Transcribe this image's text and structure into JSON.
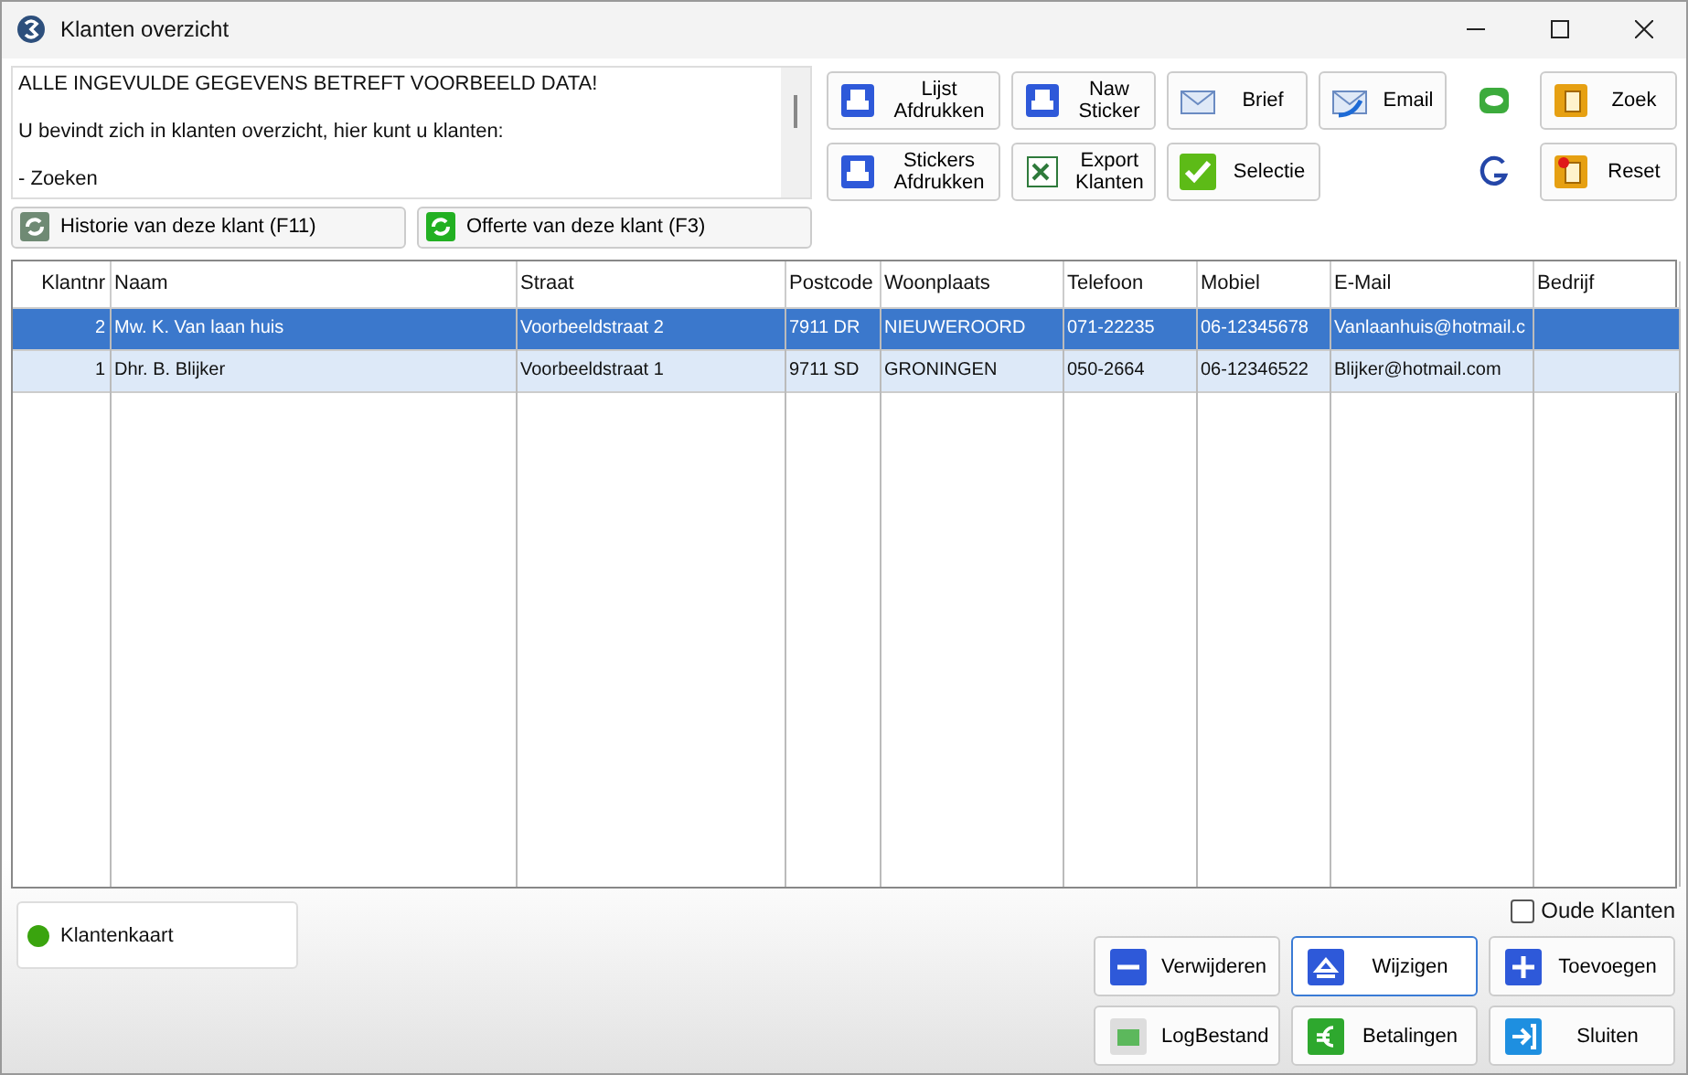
{
  "window": {
    "title": "Klanten overzicht"
  },
  "info_text": [
    "ALLE INGEVULDE GEGEVENS BETREFT VOORBEELD DATA!",
    "U bevindt zich in klanten overzicht, hier kunt u klanten:",
    "- Zoeken"
  ],
  "history_buttons": [
    {
      "label": "Historie van deze klant (F11)",
      "kind": "history"
    },
    {
      "label": "Offerte van deze klant (F3)",
      "kind": "quote"
    }
  ],
  "toolbar": [
    {
      "label": "Lijst\nAfdrukken",
      "kind": "print"
    },
    {
      "label": "Naw\nSticker",
      "kind": "print"
    },
    {
      "label": "Brief",
      "kind": "letter"
    },
    {
      "label": "Email",
      "kind": "email"
    },
    {
      "kind": "chat"
    },
    {
      "label": "Zoek",
      "kind": "search"
    },
    {
      "label": "Stickers\nAfdrukken",
      "kind": "print"
    },
    {
      "label": "Export\nKlanten",
      "kind": "excel"
    },
    {
      "label": "Selectie",
      "kind": "check"
    },
    {
      "kind": "google"
    },
    {
      "label": "Reset",
      "kind": "reset"
    }
  ],
  "table": {
    "columns": [
      "Klantnr",
      "Naam",
      "Straat",
      "Postcode",
      "Woonplaats",
      "Telefoon",
      "Mobiel",
      "E-Mail",
      "Bedrijf"
    ],
    "rows": [
      {
        "selected": true,
        "cells": [
          "2",
          "Mw. K. Van  laan huis",
          "Voorbeeldstraat 2",
          "7911 DR",
          "NIEUWEROORD",
          "071-22235",
          "06-12345678",
          "Vanlaanhuis@hotmail.c",
          ""
        ]
      },
      {
        "selected": false,
        "cells": [
          "1",
          "Dhr. B. Blijker",
          "Voorbeeldstraat 1",
          "9711 SD",
          "GRONINGEN",
          "050-2664",
          "06-12346522",
          "Blijker@hotmail.com",
          ""
        ]
      }
    ]
  },
  "old_customers": {
    "label": "Oude Klanten",
    "checked": false
  },
  "klantenkaart": {
    "label": "Klantenkaart"
  },
  "actions": [
    {
      "label": "Verwijderen",
      "kind": "minus",
      "selected": false
    },
    {
      "label": "Wijzigen",
      "kind": "edit",
      "selected": true
    },
    {
      "label": "Toevoegen",
      "kind": "plus",
      "selected": false
    },
    {
      "label": "LogBestand",
      "kind": "log",
      "selected": false
    },
    {
      "label": "Betalingen",
      "kind": "euro",
      "selected": false
    },
    {
      "label": "Sluiten",
      "kind": "exit",
      "selected": false
    }
  ]
}
